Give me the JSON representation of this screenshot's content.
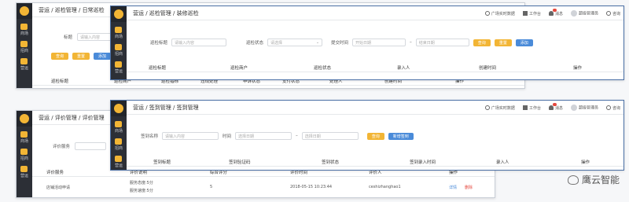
{
  "shots": {
    "s1": {
      "breadcrumb": "营运 / 巡检管理 / 日常巡检",
      "nav": [
        "商场",
        "招商",
        "营运"
      ],
      "filter_label": "标题",
      "filter_placeholder": "请输入内容",
      "buttons": [
        "查询",
        "重置",
        "添加"
      ],
      "columns": [
        "巡检标题",
        "巡检商户",
        "巡检指标",
        "违规处理",
        "申诉状态",
        "支付状态",
        "处理人",
        "创建时间",
        "操作"
      ]
    },
    "s2": {
      "breadcrumb": "营运 / 巡检管理 / 装修巡检",
      "nav": [
        "商场",
        "招商",
        "营运"
      ],
      "topbar": [
        "广场实时数据",
        "工作台",
        "消息",
        "超级管理员",
        "咨询"
      ],
      "filters": {
        "title_label": "巡检标题",
        "title_placeholder": "请输入内容",
        "status_label": "巡检状态",
        "status_placeholder": "请选择",
        "time_label": "提交时间",
        "start_placeholder": "开始日期",
        "end_placeholder": "结束日期",
        "sep": "–"
      },
      "buttons": [
        "查询",
        "重置",
        "添加"
      ],
      "columns": [
        "巡检标题",
        "巡检商户",
        "巡检状态",
        "录入人",
        "创建时间",
        "操作"
      ]
    },
    "s3": {
      "breadcrumb": "营运 / 评价管理 / 评价管理",
      "nav": [
        "商场",
        "招商",
        "营运"
      ],
      "filter_label": "评价服务",
      "columns": [
        "评价服务",
        "评价说明",
        "综合评分",
        "评价时间",
        "评价人",
        "操作"
      ],
      "row": {
        "service": "店铺活动申请",
        "desc1": "服务态度:5分",
        "desc2": "服务速度:5分",
        "score": "5",
        "time": "2018-05-15 10:23:44",
        "user": "ceshizhanghao1",
        "detail": "详情",
        "delete": "删除"
      }
    },
    "s4": {
      "breadcrumb": "营运 / 签到管理 / 签到管理",
      "nav": [
        "商场",
        "招商",
        "营运"
      ],
      "topbar": [
        "广场实时数据",
        "工作台",
        "消息",
        "超级管理员",
        "咨询"
      ],
      "filters": {
        "name_label": "签到名称",
        "name_placeholder": "请输入内容",
        "time_label": "时间",
        "start_placeholder": "选择日期",
        "end_placeholder": "选择日期",
        "sep": "–"
      },
      "buttons": [
        "查询",
        "新增签到"
      ],
      "columns": [
        "签到标题",
        "签到验证码",
        "签到状态",
        "签到录入时间",
        "录入人",
        "操作"
      ]
    }
  },
  "watermark": "鹰云智能",
  "colors": {
    "sidebar": "#2c2f36",
    "accent_orange": "#f2b535",
    "accent_blue": "#4a8bd9",
    "danger": "#e5483e"
  }
}
